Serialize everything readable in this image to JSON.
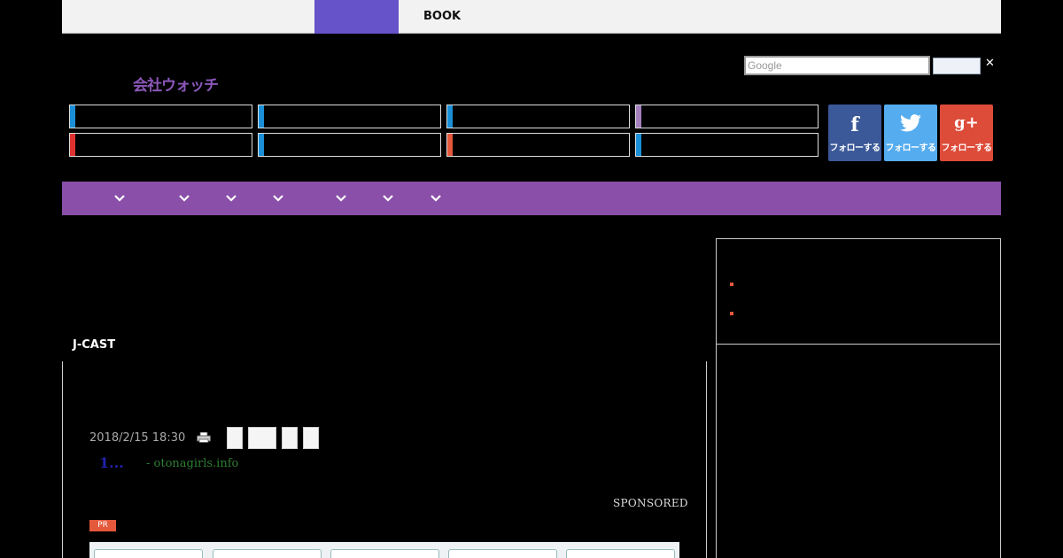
{
  "topbar": {
    "book_label": "BOOK"
  },
  "logo": {
    "text": "会社ウォッチ"
  },
  "search": {
    "placeholder": "Google",
    "close_glyph": "✕"
  },
  "category_bar_colors": [
    "#1a8fd8",
    "#1a8fd8",
    "#1a8fd8",
    "#a37fbd",
    "#e03131",
    "#1a8fd8",
    "#e4583c",
    "#1a8fd8"
  ],
  "social": {
    "facebook": {
      "glyph": "f",
      "label": "フォローする",
      "color": "#3b5998"
    },
    "twitter": {
      "glyph": "🐦",
      "label": "フォローする",
      "color": "#55acee"
    },
    "googleplus": {
      "glyph": "g+",
      "label": "フォローする",
      "color": "#dd4b39"
    }
  },
  "navbar": {
    "color": "#8a4fa9",
    "dropdown_icon": "chevron-down-icon"
  },
  "article": {
    "section_label": "J-CAST",
    "date": "2018/2/15 18:30",
    "related_number": "1...",
    "related_source": "- otonagirls.info",
    "sponsored_label": "SPONSORED",
    "pr_badge": "PR"
  }
}
